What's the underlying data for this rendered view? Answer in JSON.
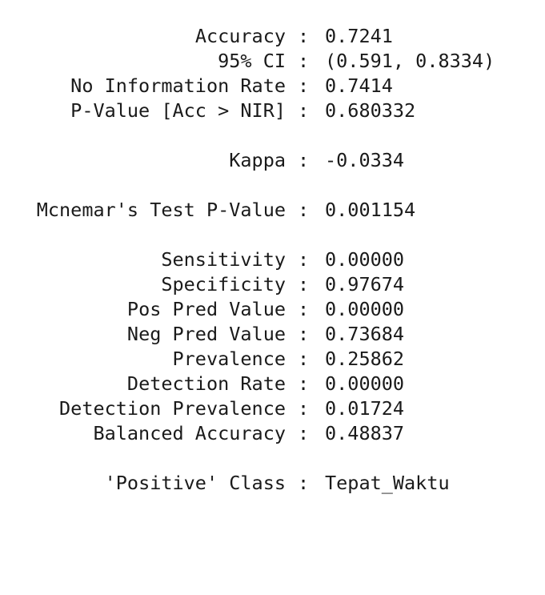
{
  "output": {
    "separator": ":",
    "rows": [
      {
        "label": "Accuracy",
        "value": "0.7241"
      },
      {
        "label": "95% CI",
        "value": "(0.591, 0.8334)"
      },
      {
        "label": "No Information Rate",
        "value": "0.7414"
      },
      {
        "label": "P-Value [Acc > NIR]",
        "value": "0.680332"
      },
      {
        "label": "Kappa",
        "value": "-0.0334"
      },
      {
        "label": "Mcnemar's Test P-Value",
        "value": "0.001154"
      },
      {
        "label": "Sensitivity",
        "value": "0.00000"
      },
      {
        "label": "Specificity",
        "value": "0.97674"
      },
      {
        "label": "Pos Pred Value",
        "value": "0.00000"
      },
      {
        "label": "Neg Pred Value",
        "value": "0.73684"
      },
      {
        "label": "Prevalence",
        "value": "0.25862"
      },
      {
        "label": "Detection Rate",
        "value": "0.00000"
      },
      {
        "label": "Detection Prevalence",
        "value": "0.01724"
      },
      {
        "label": "Balanced Accuracy",
        "value": "0.48837"
      },
      {
        "label": "'Positive' Class",
        "value": "Tepat_Waktu"
      }
    ]
  }
}
